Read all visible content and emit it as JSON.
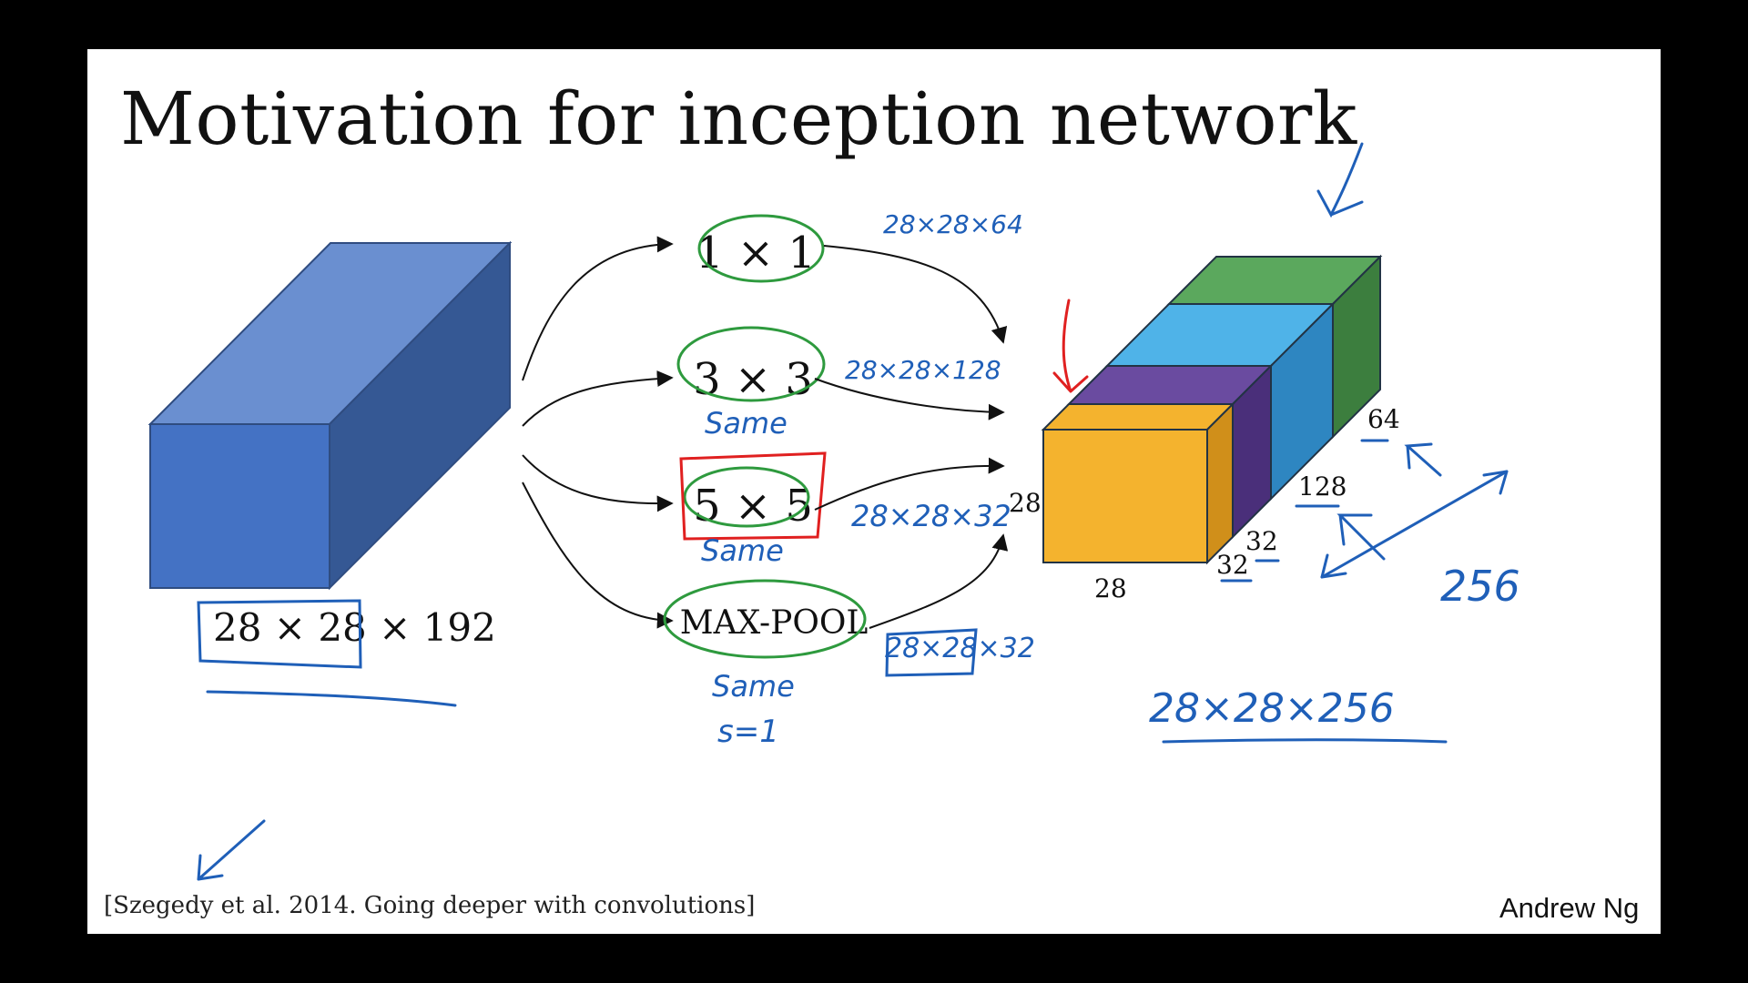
{
  "slide": {
    "title": "Motivation for inception network",
    "citation": "[Szegedy et al. 2014. Going deeper with convolutions]",
    "author": "Andrew Ng"
  },
  "input_volume": {
    "dims_label": "28 × 28 × 192",
    "color_front": "#4472C4",
    "color_top": "#6A8FD0",
    "color_side": "#355894"
  },
  "operations": [
    {
      "label": "1 × 1",
      "annotation": "28×28×64",
      "padding_note": ""
    },
    {
      "label": "3 × 3",
      "annotation": "28×28×128",
      "padding_note": "Same"
    },
    {
      "label": "5 × 5",
      "annotation": "28×28×32",
      "padding_note": "Same"
    },
    {
      "label": "MAX-POOL",
      "annotation": "28×28×32",
      "padding_note": "Same",
      "stride_note": "s=1"
    }
  ],
  "output_volume": {
    "height_label": "28",
    "width_label": "28",
    "depth_labels": [
      "32",
      "32",
      "128",
      "64"
    ],
    "blocks": [
      {
        "name": "1x1 output",
        "color": "#5BA85D"
      },
      {
        "name": "3x3 output",
        "color": "#4FB3E8"
      },
      {
        "name": "5x5 output",
        "color": "#6A4BA0"
      },
      {
        "name": "max-pool output",
        "color": "#F4B32E"
      }
    ],
    "total_depth_note": "256",
    "total_dims_note": "28×28×256"
  },
  "colors": {
    "ink_blue": "#1F5FB8",
    "ink_green": "#2E9A3E",
    "ink_red": "#E02020",
    "arrow": "#111111"
  }
}
